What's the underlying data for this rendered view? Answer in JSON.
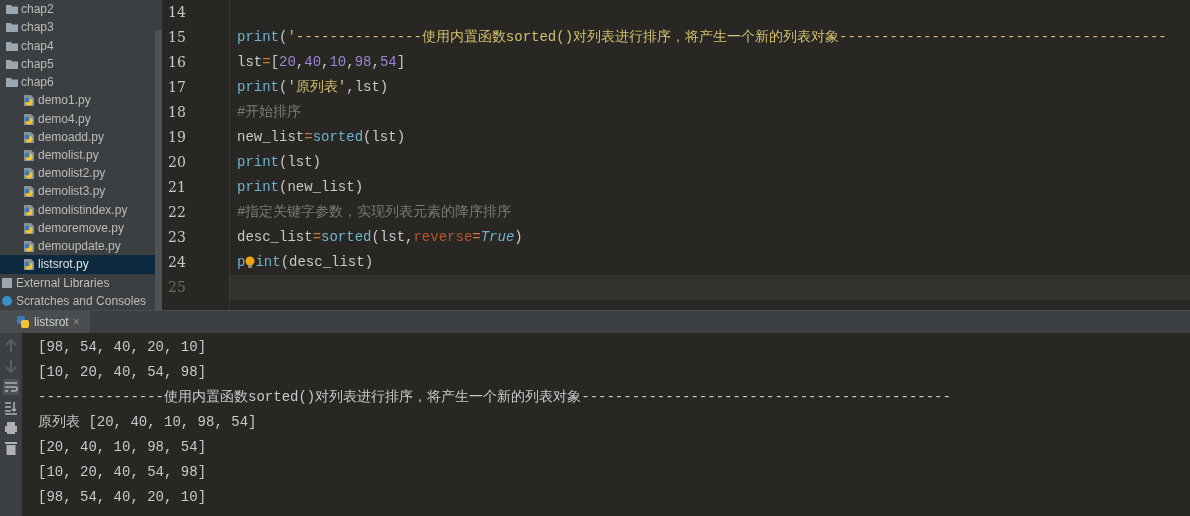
{
  "project_tree": [
    {
      "label": "chap2",
      "kind": "folder",
      "selected": false
    },
    {
      "label": "chap3",
      "kind": "folder",
      "selected": false
    },
    {
      "label": "chap4",
      "kind": "folder",
      "selected": false
    },
    {
      "label": "chap5",
      "kind": "folder",
      "selected": false
    },
    {
      "label": "chap6",
      "kind": "folder",
      "selected": false,
      "children": [
        {
          "label": "demo1.py",
          "kind": "python",
          "selected": false
        },
        {
          "label": "demo4.py",
          "kind": "python",
          "selected": false
        },
        {
          "label": "demoadd.py",
          "kind": "python",
          "selected": false
        },
        {
          "label": "demolist.py",
          "kind": "python",
          "selected": false
        },
        {
          "label": "demolist2.py",
          "kind": "python",
          "selected": false
        },
        {
          "label": "demolist3.py",
          "kind": "python",
          "selected": false
        },
        {
          "label": "demolistindex.py",
          "kind": "python",
          "selected": false
        },
        {
          "label": "demoremove.py",
          "kind": "python",
          "selected": false
        },
        {
          "label": "demoupdate.py",
          "kind": "python",
          "selected": false
        },
        {
          "label": "listsrot.py",
          "kind": "python",
          "selected": true
        }
      ]
    },
    {
      "label": "External Libraries",
      "kind": "library",
      "selected": false
    },
    {
      "label": "Scratches and Consoles",
      "kind": "scratch",
      "selected": false
    }
  ],
  "editor": {
    "lines": [
      {
        "number": "14",
        "current": false
      },
      {
        "number": "15",
        "current": false,
        "tokens": [
          {
            "text": "print",
            "kind": "builtin"
          },
          {
            "text": "(",
            "kind": "plain"
          },
          {
            "text": "'---------------使用内置函数sorted()对列表进行排序，将产生一个新的列表对象---------------------------------------",
            "kind": "string"
          }
        ]
      },
      {
        "number": "16",
        "current": false,
        "tokens": [
          {
            "text": "lst",
            "kind": "plain"
          },
          {
            "text": "=",
            "kind": "operator"
          },
          {
            "text": "[",
            "kind": "plain"
          },
          {
            "text": "20",
            "kind": "number"
          },
          {
            "text": ",",
            "kind": "plain"
          },
          {
            "text": "40",
            "kind": "number"
          },
          {
            "text": ",",
            "kind": "plain"
          },
          {
            "text": "10",
            "kind": "number"
          },
          {
            "text": ",",
            "kind": "plain"
          },
          {
            "text": "98",
            "kind": "number"
          },
          {
            "text": ",",
            "kind": "plain"
          },
          {
            "text": "54",
            "kind": "number"
          },
          {
            "text": "]",
            "kind": "plain"
          }
        ]
      },
      {
        "number": "17",
        "current": false,
        "tokens": [
          {
            "text": "print",
            "kind": "builtin"
          },
          {
            "text": "(",
            "kind": "plain"
          },
          {
            "text": "'原列表'",
            "kind": "string"
          },
          {
            "text": ",lst)",
            "kind": "plain"
          }
        ]
      },
      {
        "number": "18",
        "current": false,
        "tokens": [
          {
            "text": "#开始排序",
            "kind": "comment"
          }
        ]
      },
      {
        "number": "19",
        "current": false,
        "tokens": [
          {
            "text": "new_list",
            "kind": "plain"
          },
          {
            "text": "=",
            "kind": "operator"
          },
          {
            "text": "sorted",
            "kind": "builtin"
          },
          {
            "text": "(lst)",
            "kind": "plain"
          }
        ]
      },
      {
        "number": "20",
        "current": false,
        "tokens": [
          {
            "text": "print",
            "kind": "builtin"
          },
          {
            "text": "(lst)",
            "kind": "plain"
          }
        ]
      },
      {
        "number": "21",
        "current": false,
        "tokens": [
          {
            "text": "print",
            "kind": "builtin"
          },
          {
            "text": "(new_list)",
            "kind": "plain"
          }
        ]
      },
      {
        "number": "22",
        "current": false,
        "tokens": [
          {
            "text": "#指定关键字参数，实现列表元素的降序排序",
            "kind": "comment"
          }
        ]
      },
      {
        "number": "23",
        "current": false,
        "tokens": [
          {
            "text": "desc_list",
            "kind": "plain"
          },
          {
            "text": "=",
            "kind": "operator"
          },
          {
            "text": "sorted",
            "kind": "builtin"
          },
          {
            "text": "(lst,",
            "kind": "plain"
          },
          {
            "text": "reverse",
            "kind": "keyword_arg"
          },
          {
            "text": "=",
            "kind": "operator"
          },
          {
            "text": "True",
            "kind": "constant"
          },
          {
            "text": ")",
            "kind": "plain"
          }
        ]
      },
      {
        "number": "24",
        "current": false,
        "tokens": [
          {
            "text": "p",
            "kind": "builtin"
          },
          {
            "kind": "bulb"
          },
          {
            "text": "int",
            "kind": "builtin"
          },
          {
            "text": "(desc_list)",
            "kind": "plain"
          }
        ]
      },
      {
        "number": "25",
        "current": true
      }
    ]
  },
  "run_panel": {
    "tab": {
      "label": "listsrot",
      "close": "×",
      "selected": true
    },
    "output": [
      "[98, 54, 40, 20, 10]",
      "[10, 20, 40, 54, 98]",
      "---------------使用内置函数sorted()对列表进行排序，将产生一个新的列表对象--------------------------------------------",
      "原列表 [20, 40, 10, 98, 54]",
      "[20, 40, 10, 98, 54]",
      "[10, 20, 40, 54, 98]",
      "[98, 54, 40, 20, 10]"
    ]
  }
}
